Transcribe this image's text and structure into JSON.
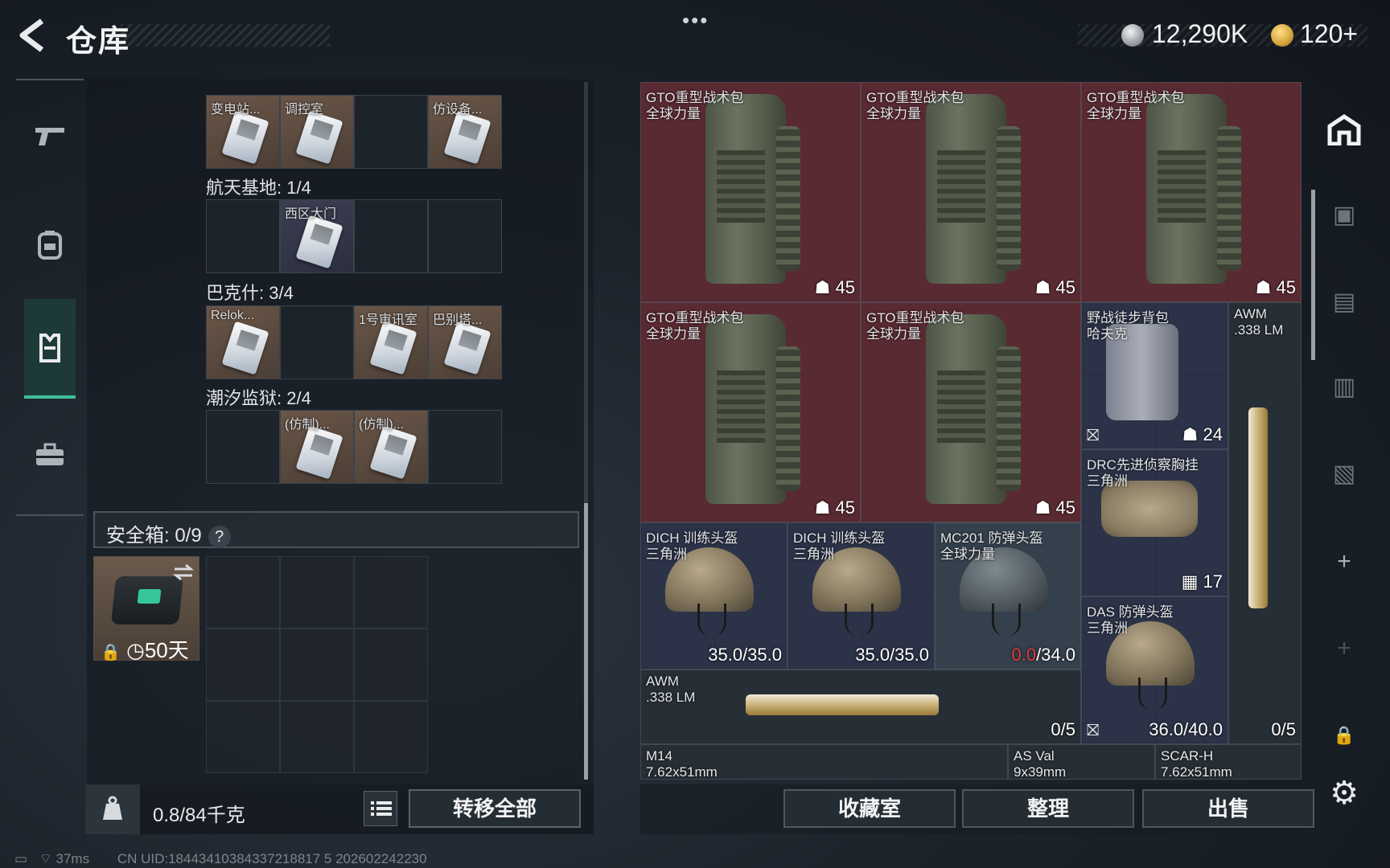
{
  "header": {
    "title": "仓库",
    "currency_silver": "12,290K",
    "currency_gold": "120+",
    "menu_dots": "•••"
  },
  "left_rail": {
    "items": [
      "weapons",
      "backpack",
      "armor",
      "case"
    ]
  },
  "key_groups": [
    {
      "label": "",
      "slots": [
        "变电站...",
        "调控室",
        "",
        "仿设备..."
      ]
    },
    {
      "label": "航天基地: 1/4",
      "slots": [
        "",
        "西区大门",
        "",
        ""
      ]
    },
    {
      "label": "巴克什: 3/4",
      "slots": [
        "Relok...",
        "",
        "1号审讯室",
        "巴别塔..."
      ]
    },
    {
      "label": "潮汐监狱: 2/4",
      "slots": [
        "",
        "(仿制)...",
        "(仿制)...",
        ""
      ]
    }
  ],
  "safe": {
    "title": "安全箱: 0/9",
    "help": "?",
    "days": "50天"
  },
  "weight": {
    "value": "0.8/84千克"
  },
  "buttons": {
    "transfer_all": "转移全部",
    "collection": "收藏室",
    "organize": "整理",
    "sell": "出售"
  },
  "inventory": [
    {
      "n1": "GTO重型战术包",
      "n2": "全球力量",
      "stat": "45"
    },
    {
      "n1": "GTO重型战术包",
      "n2": "全球力量",
      "stat": "45"
    },
    {
      "n1": "GTO重型战术包",
      "n2": "全球力量",
      "stat": "45"
    },
    {
      "n1": "GTO重型战术包",
      "n2": "全球力量",
      "stat": "45"
    },
    {
      "n1": "GTO重型战术包",
      "n2": "全球力量",
      "stat": "45"
    },
    {
      "n1": "野战徒步背包",
      "n2": "哈夫克",
      "stat": "24"
    },
    {
      "n1": "AWM",
      "n2": ".338 LM",
      "stat": "0/5"
    },
    {
      "n1": "DRC先进侦察胸挂",
      "n2": "三角洲",
      "stat": "17"
    },
    {
      "n1": "DICH 训练头盔",
      "n2": "三角洲",
      "stat": "35.0/35.0"
    },
    {
      "n1": "DICH 训练头盔",
      "n2": "三角洲",
      "stat": "35.0/35.0"
    },
    {
      "n1": "MC201 防弹头盔",
      "n2": "全球力量",
      "stat_red": "0.0",
      "stat": "/34.0"
    },
    {
      "n1": "DAS 防弹头盔",
      "n2": "三角洲",
      "stat": "36.0/40.0"
    },
    {
      "n1": "AWM",
      "n2": ".338 LM",
      "stat": "0/5"
    },
    {
      "n1": "M14",
      "n2": "7.62x51mm"
    },
    {
      "n1": "AS Val",
      "n2": "9x39mm"
    },
    {
      "n1": "SCAR-H",
      "n2": "7.62x51mm"
    }
  ],
  "status_bar": {
    "ping": "37ms",
    "uid": "CN UID:18443410384337218817 5 202602242230"
  }
}
